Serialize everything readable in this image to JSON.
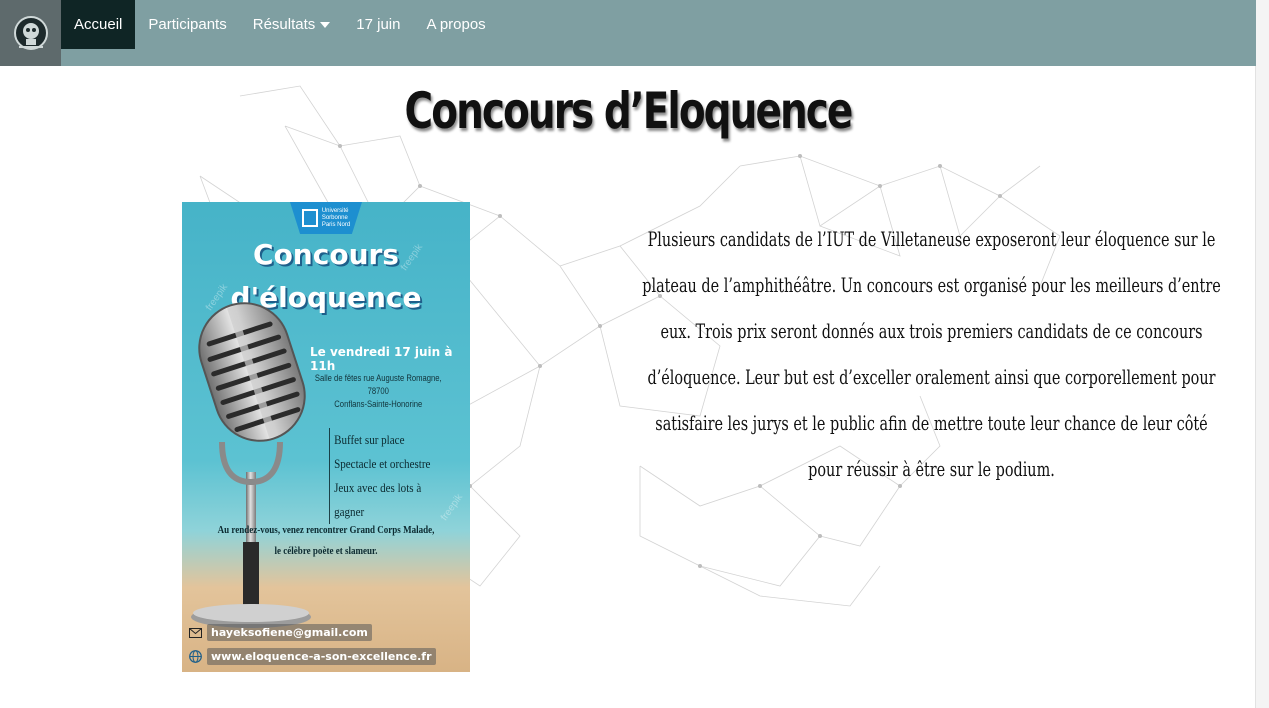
{
  "navbar": {
    "logo_alt": "logo",
    "items": [
      {
        "label": "Accueil",
        "active": true
      },
      {
        "label": "Participants"
      },
      {
        "label": "Résultats",
        "dropdown": true
      },
      {
        "label": "17 juin"
      },
      {
        "label": "A propos"
      }
    ],
    "bg_color": "#7f9fa2",
    "active_color": "#0f2525"
  },
  "page": {
    "title": "Concours d’Eloquence",
    "description": "Plusieurs candidats de l’IUT de Villetaneuse exposeront leur éloquence sur le plateau de l’amphithéâtre. Un concours est organisé pour les meilleurs d’entre eux. Trois prix seront donnés aux trois premiers candidats de ce concours d’éloquence. Leur but est d’exceller oralement ainsi que corporellement pour satisfaire les jurys et le public afin de mettre toute leur chance de leur côté pour réussir à être sur le podium."
  },
  "poster": {
    "university": [
      "Université",
      "Sorbonne",
      "Paris Nord"
    ],
    "title_line1": "Concours",
    "title_line2": "d'éloquence",
    "date": "Le vendredi 17 juin à 11h",
    "venue_line1": "Salle de fêtes rue Auguste Romagne, 78700",
    "venue_line2": "Conflans-Sainte-Honorine",
    "features": [
      "Buffet sur place",
      "Spectacle et orchestre",
      "Jeux avec des lots à gagner"
    ],
    "rdv_line1": "Au rendez-vous, venez rencontrer Grand Corps Malade,",
    "rdv_line2": "le célèbre poète et slameur.",
    "email": "hayeksofiene@gmail.com",
    "website": "www.eloquence-a-son-excellence.fr",
    "watermark": "freepik"
  }
}
